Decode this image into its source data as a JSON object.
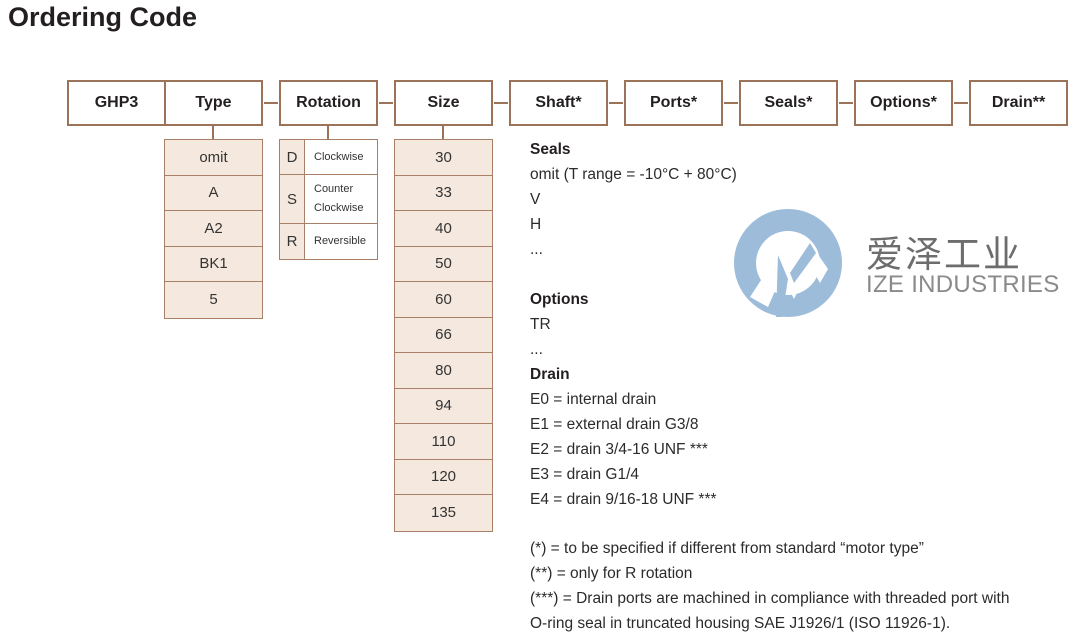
{
  "title": "Ordering Code",
  "header_boxes": [
    "GHP3",
    "Type",
    "Rotation",
    "Size",
    "Shaft*",
    "Ports*",
    "Seals*",
    "Options*",
    "Drain**"
  ],
  "type_options": [
    "omit",
    "A",
    "A2",
    "BK1",
    "5"
  ],
  "rotation_options": [
    {
      "code": "D",
      "line1": "Clockwise",
      "line2": ""
    },
    {
      "code": "S",
      "line1": "Counter",
      "line2": "Clockwise"
    },
    {
      "code": "R",
      "line1": "Reversible",
      "line2": ""
    }
  ],
  "size_options": [
    "30",
    "33",
    "40",
    "50",
    "60",
    "66",
    "80",
    "94",
    "110",
    "120",
    "135"
  ],
  "seals": {
    "heading": "Seals",
    "items": [
      "omit (T range = -10°C + 80°C)",
      "V",
      "H",
      "..."
    ]
  },
  "options": {
    "heading": "Options",
    "items": [
      "TR",
      "..."
    ]
  },
  "drain": {
    "heading": "Drain",
    "items": [
      "E0 = internal drain",
      "E1 = external drain G3/8",
      "E2 = drain 3/4-16 UNF ***",
      "E3 = drain G1/4",
      "E4 = drain 9/16-18 UNF ***"
    ]
  },
  "footnotes": [
    "(*) = to be specified if different from standard “motor type”",
    "(**) = only for R rotation",
    "(***) = Drain ports are machined in compliance with threaded port with",
    "O-ring seal in truncated housing SAE J1926/1 (ISO 11926-1)."
  ],
  "watermark": {
    "name_cn": "爱泽工业",
    "name_en": "IZE INDUSTRIES",
    "color": "#9dbcd9"
  },
  "colors": {
    "border": "#9b7358",
    "cell_fill": "#f5e9df"
  }
}
